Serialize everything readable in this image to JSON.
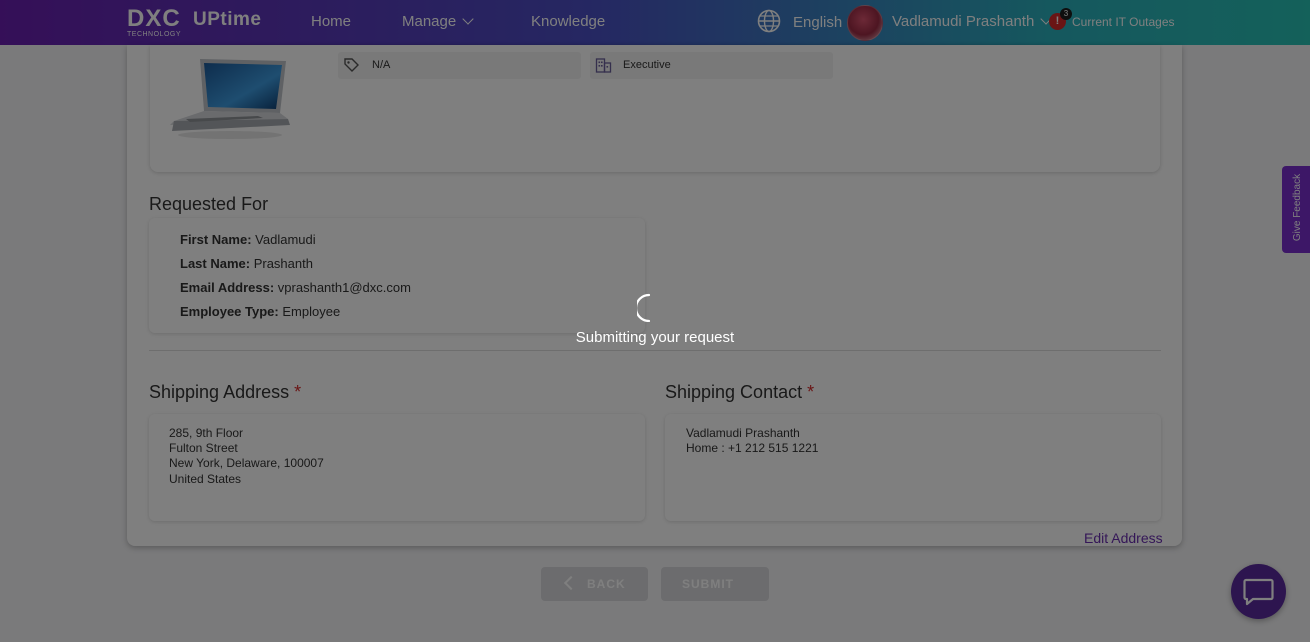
{
  "header": {
    "logo_main": "DXC",
    "logo_sub": "TECHNOLOGY",
    "logo_product": "UPtime",
    "nav": [
      {
        "label": "Home"
      },
      {
        "label": "Manage"
      },
      {
        "label": "Knowledge"
      }
    ],
    "language": "English",
    "user_name": "Vadlamudi Prashanth",
    "alert_symbol": "!",
    "alert_count": "3",
    "outages_label": "Current IT Outages",
    "icons": [
      "globe-icon",
      "chevron-down-icon",
      "alert-icon"
    ]
  },
  "product": {
    "tag_value": "N/A",
    "category_value": "Executive",
    "icons": [
      "tag-icon",
      "building-icon",
      "laptop-image"
    ]
  },
  "requested_for": {
    "title": "Requested For",
    "first_name_label": "First Name:",
    "first_name": "Vadlamudi",
    "last_name_label": "Last Name:",
    "last_name": "Prashanth",
    "email_label": "Email Address:",
    "email": "vprashanth1@dxc.com",
    "employee_type_label": "Employee Type:",
    "employee_type": "Employee"
  },
  "shipping_address": {
    "title": "Shipping Address",
    "required_mark": "*",
    "lines": [
      "285, 9th Floor",
      "Fulton Street",
      "New York, Delaware, 100007",
      "United States"
    ]
  },
  "shipping_contact": {
    "title": "Shipping Contact",
    "required_mark": "*",
    "lines": [
      "Vadlamudi Prashanth",
      "Home : +1 212 515 1221"
    ]
  },
  "edit_address_label": "Edit Address",
  "buttons": {
    "back": "BACK",
    "submit": "SUBMIT"
  },
  "feedback_label": "Give Feedback",
  "overlay": {
    "loading_text": "Submitting your request",
    "icon": "spinner-icon"
  },
  "colors": {
    "header_gradient": [
      "#6a1fb0",
      "#2bb0bd"
    ],
    "accent_purple": "#7a2fcf",
    "chat_button": "#5a2b9f",
    "required_red": "#d42a2a"
  }
}
